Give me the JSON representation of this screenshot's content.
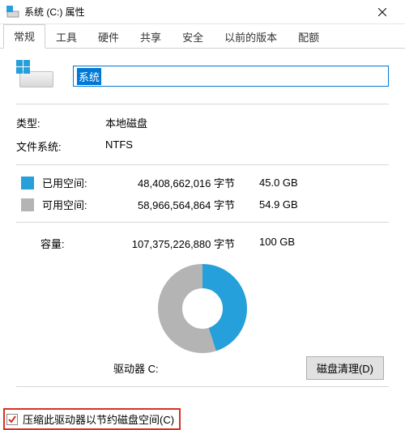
{
  "titlebar": {
    "title": "系统 (C:) 属性"
  },
  "tabs": [
    {
      "label": "常规",
      "active": true
    },
    {
      "label": "工具",
      "active": false
    },
    {
      "label": "硬件",
      "active": false
    },
    {
      "label": "共享",
      "active": false
    },
    {
      "label": "安全",
      "active": false
    },
    {
      "label": "以前的版本",
      "active": false
    },
    {
      "label": "配额",
      "active": false
    }
  ],
  "drive": {
    "name_value": "系统",
    "type_label": "类型:",
    "type_value": "本地磁盘",
    "fs_label": "文件系统:",
    "fs_value": "NTFS"
  },
  "space": {
    "used_label": "已用空间:",
    "used_bytes": "48,408,662,016 字节",
    "used_human": "45.0 GB",
    "free_label": "可用空间:",
    "free_bytes": "58,966,564,864 字节",
    "free_human": "54.9 GB",
    "cap_label": "容量:",
    "cap_bytes": "107,375,226,880 字节",
    "cap_human": "100 GB"
  },
  "chart_data": {
    "type": "pie",
    "title": "驱动器 C:",
    "series": [
      {
        "name": "已用空间",
        "value": 48408662016,
        "color": "#26a0da"
      },
      {
        "name": "可用空间",
        "value": 58966564864,
        "color": "#b4b4b4"
      }
    ],
    "total": 107375226880
  },
  "donut": {
    "drive_label": "驱动器 C:",
    "cleanup_button": "磁盘清理(D)"
  },
  "compress": {
    "label": "压缩此驱动器以节约磁盘空间(C)",
    "checked": true
  },
  "colors": {
    "accent": "#0078d7",
    "used": "#26a0da",
    "free": "#b4b4b4",
    "highlight_border": "#d93025"
  }
}
